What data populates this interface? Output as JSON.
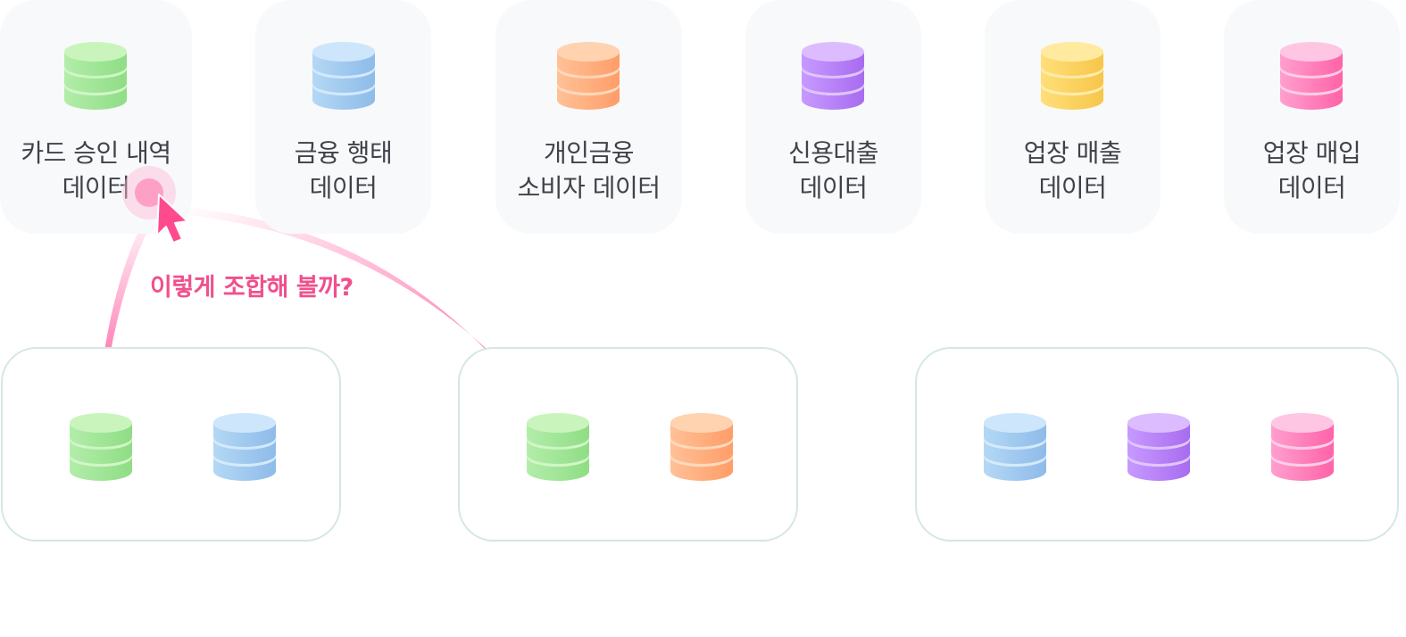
{
  "db_colors": {
    "green": {
      "top": "#c9f5bd",
      "light": "#b3edaa",
      "dark": "#8fdd85"
    },
    "blue": {
      "top": "#cde6fb",
      "light": "#b4d8f5",
      "dark": "#8ebbe9"
    },
    "orange": {
      "top": "#ffd3b0",
      "light": "#ffc197",
      "dark": "#ff9d68"
    },
    "purple": {
      "top": "#dcbcff",
      "light": "#c79aff",
      "dark": "#a86cf0"
    },
    "yellow": {
      "top": "#ffeaa0",
      "light": "#ffdf79",
      "dark": "#f7c64a"
    },
    "pink": {
      "top": "#ffc6e3",
      "light": "#ff9fcf",
      "dark": "#ff63a8"
    }
  },
  "data_sources": [
    {
      "line1": "카드 승인 내역",
      "line2": "데이터",
      "icon": "green"
    },
    {
      "line1": "금융 행태",
      "line2": "데이터",
      "icon": "blue"
    },
    {
      "line1": "개인금융",
      "line2": "소비자 데이터",
      "icon": "orange"
    },
    {
      "line1": "신용대출",
      "line2": "데이터",
      "icon": "purple"
    },
    {
      "line1": "업장 매출",
      "line2": "데이터",
      "icon": "yellow"
    },
    {
      "line1": "업장 매입",
      "line2": "데이터",
      "icon": "pink"
    }
  ],
  "caption": "이렇게 조합해 볼까?",
  "combinations": [
    {
      "icons": [
        "green",
        "blue"
      ]
    },
    {
      "icons": [
        "green",
        "orange"
      ]
    },
    {
      "icons": [
        "blue",
        "purple",
        "pink"
      ]
    }
  ]
}
